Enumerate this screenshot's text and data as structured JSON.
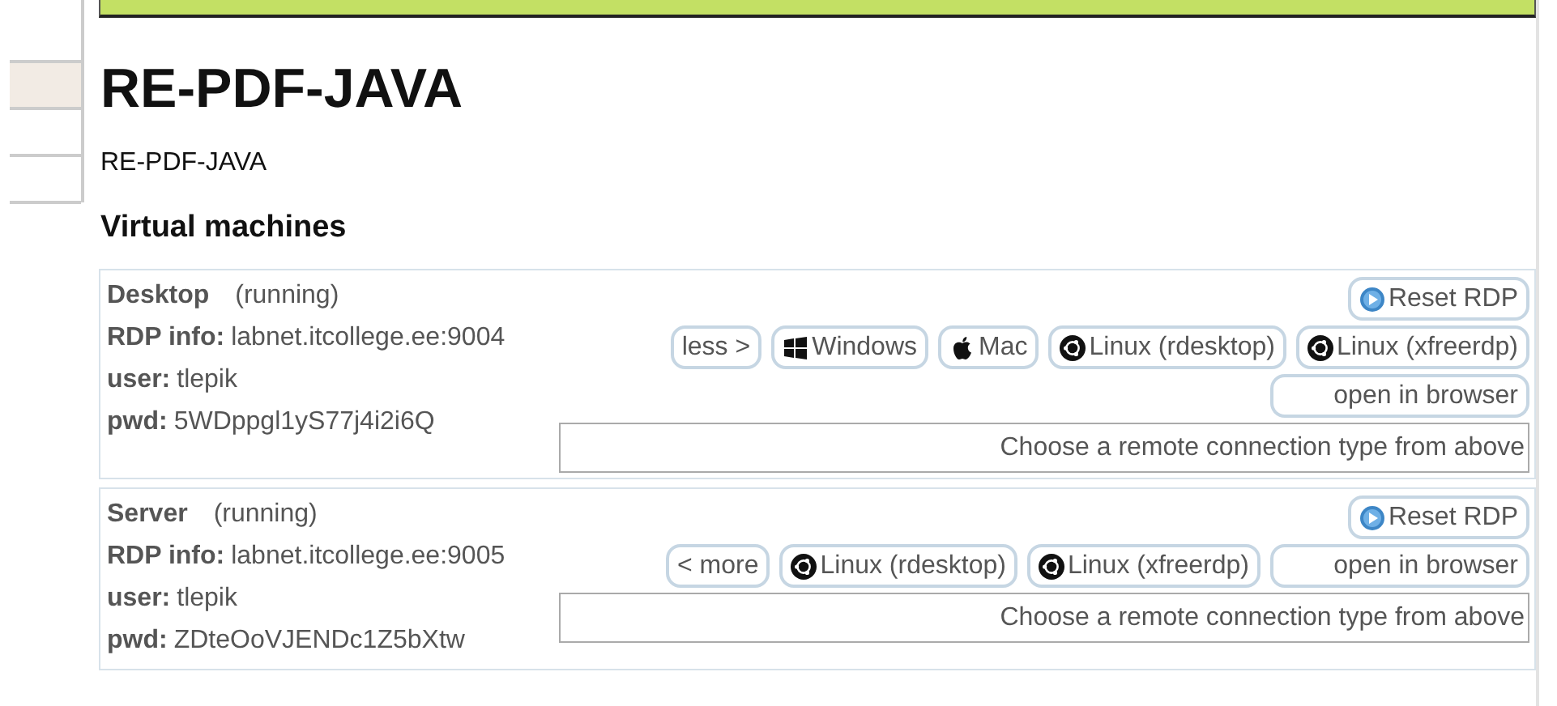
{
  "sidebar": {
    "items": [
      {
        "selected": true
      },
      {
        "selected": false
      },
      {
        "selected": false
      }
    ]
  },
  "title": "RE-PDF-JAVA",
  "description": "RE-PDF-JAVA",
  "section_title": "Virtual machines",
  "machines": [
    {
      "name": "Desktop",
      "status": "(running)",
      "rdp_label": "RDP info:",
      "rdp": "labnet.itcollege.ee:9004",
      "user_label": "user:",
      "user": "tlepik",
      "pwd_label": "pwd:",
      "pwd": "5WDppgl1yS77j4i2i6Q",
      "reset": {
        "label": "Reset RDP",
        "kind": "play"
      },
      "buttons": [
        {
          "label": "less >",
          "kind": "plain"
        },
        {
          "label": "Windows",
          "kind": "windows"
        },
        {
          "label": "Mac",
          "kind": "apple"
        },
        {
          "label": "Linux (rdesktop)",
          "kind": "ubuntu"
        },
        {
          "label": "Linux (xfreerdp)",
          "kind": "ubuntu"
        },
        {
          "label": "open in browser",
          "kind": "wide"
        }
      ],
      "message": "Choose a remote connection type from above"
    },
    {
      "name": "Server",
      "status": "(running)",
      "rdp_label": "RDP info:",
      "rdp": "labnet.itcollege.ee:9005",
      "user_label": "user:",
      "user": "tlepik",
      "pwd_label": "pwd:",
      "pwd": "ZDteOoVJENDc1Z5bXtw",
      "reset": {
        "label": "Reset RDP",
        "kind": "play"
      },
      "buttons": [
        {
          "label": "< more",
          "kind": "plain"
        },
        {
          "label": "Linux (rdesktop)",
          "kind": "ubuntu"
        },
        {
          "label": "Linux (xfreerdp)",
          "kind": "ubuntu"
        },
        {
          "label": "open in browser",
          "kind": "wide"
        }
      ],
      "message": "Choose a remote connection type from above"
    }
  ]
}
